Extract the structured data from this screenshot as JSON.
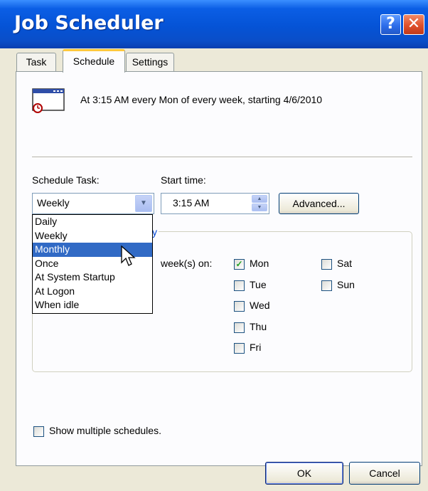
{
  "window": {
    "title": "Job Scheduler",
    "help_label": "?",
    "close_label": "✕"
  },
  "tabs": [
    "Task",
    "Schedule",
    "Settings"
  ],
  "active_tab": "Schedule",
  "summary": "At 3:15 AM every Mon of every week, starting 4/6/2010",
  "schedule_task": {
    "label": "Schedule Task:",
    "value": "Weekly",
    "options": [
      "Daily",
      "Weekly",
      "Monthly",
      "Once",
      "At System Startup",
      "At Logon",
      "When idle"
    ],
    "highlighted": "Monthly"
  },
  "start_time": {
    "label": "Start time:",
    "value": "3:15 AM"
  },
  "advanced_button": "Advanced...",
  "group": {
    "title_fragment": "y",
    "every_label": "week(s) on:",
    "days": [
      {
        "label": "Mon",
        "checked": true
      },
      {
        "label": "Tue",
        "checked": false
      },
      {
        "label": "Wed",
        "checked": false
      },
      {
        "label": "Thu",
        "checked": false
      },
      {
        "label": "Fri",
        "checked": false
      },
      {
        "label": "Sat",
        "checked": false
      },
      {
        "label": "Sun",
        "checked": false
      }
    ]
  },
  "show_multiple": {
    "label": "Show multiple schedules.",
    "checked": false
  },
  "buttons": {
    "ok": "OK",
    "cancel": "Cancel"
  },
  "colors": {
    "titlebar": "#0553d6",
    "selection": "#316ac5",
    "check": "#21a121",
    "tab_highlight": "#ffc83c"
  },
  "icons": [
    "task-schedule-icon",
    "dropdown-arrow-icon",
    "spin-up-icon",
    "spin-down-icon",
    "mouse-pointer-icon",
    "checkmark-icon"
  ]
}
